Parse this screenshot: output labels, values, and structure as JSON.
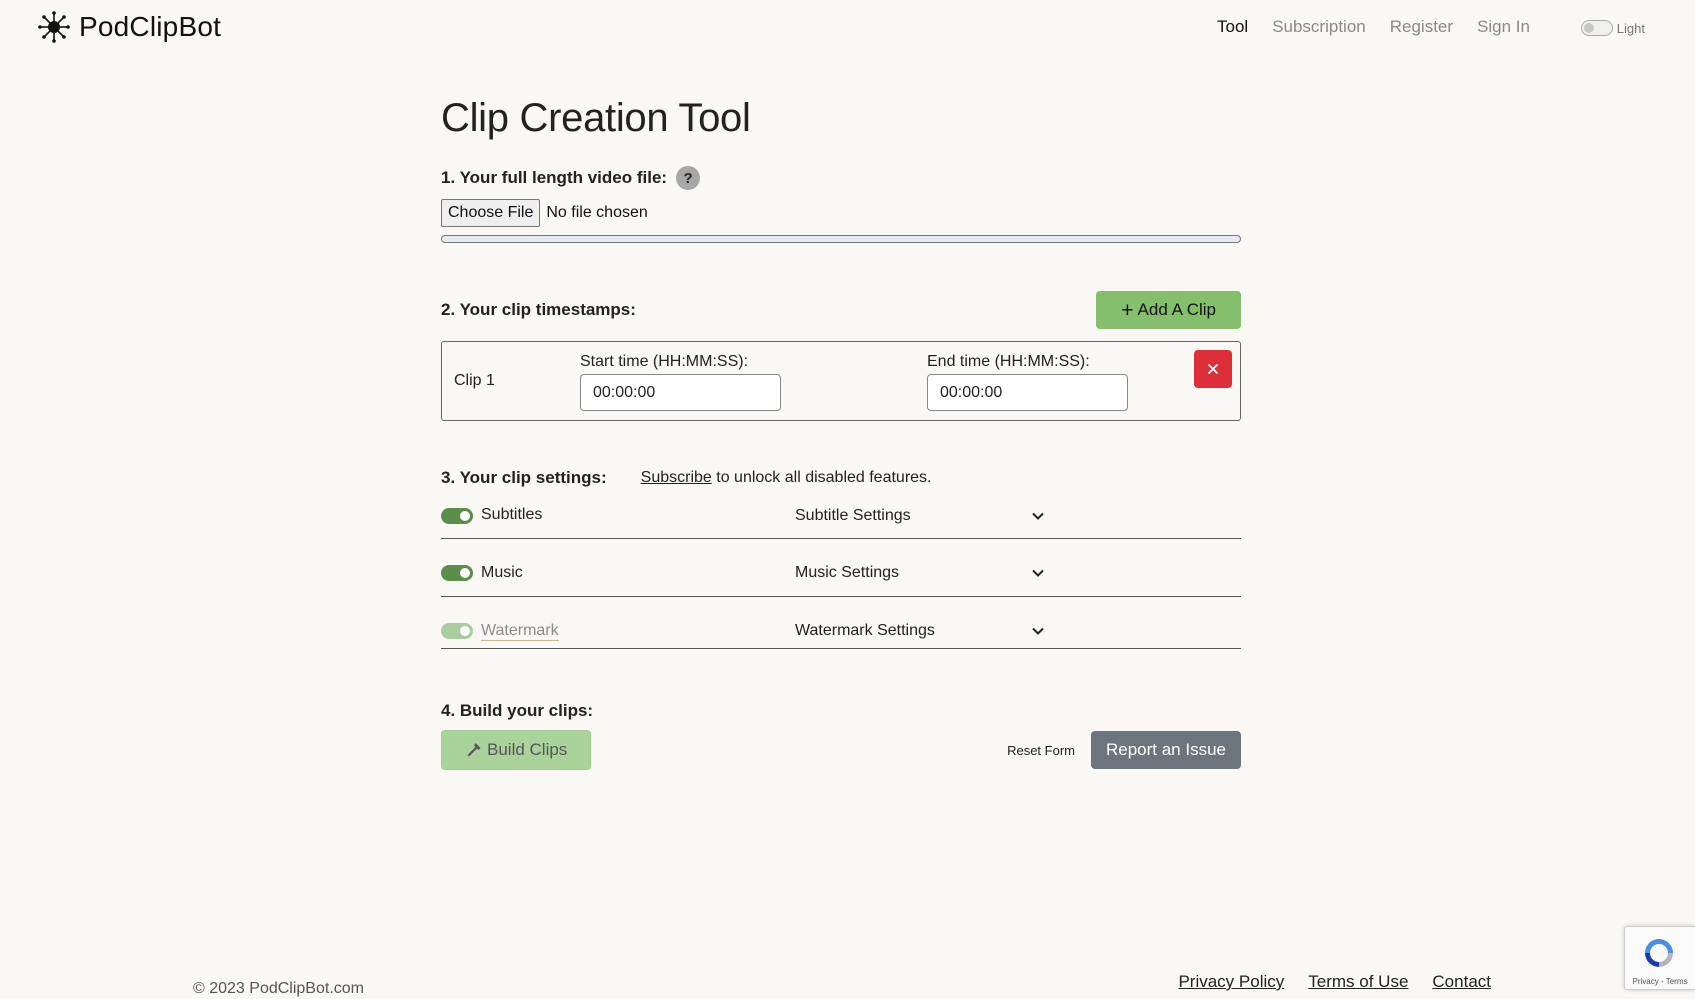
{
  "brand": {
    "name": "PodClipBot"
  },
  "nav": {
    "items": [
      {
        "label": "Tool"
      },
      {
        "label": "Subscription"
      },
      {
        "label": "Register"
      },
      {
        "label": "Sign In"
      }
    ],
    "theme_label": "Light"
  },
  "page": {
    "title": "Clip Creation Tool"
  },
  "step1": {
    "label": "1. Your full length video file:",
    "help_symbol": "?",
    "choose_file_label": "Choose File",
    "file_status": "No file chosen",
    "progress_percent": 0
  },
  "step2": {
    "label": "2. Your clip timestamps:",
    "add_clip_label": "Add A Clip",
    "clips": [
      {
        "label": "Clip 1",
        "start_label": "Start time (HH:MM:SS):",
        "start_value": "00:00:00",
        "end_label": "End time (HH:MM:SS):",
        "end_value": "00:00:00"
      }
    ]
  },
  "step3": {
    "label": "3. Your clip settings:",
    "subscribe_link": "Subscribe",
    "unlock_text": "to unlock all disabled features.",
    "features": [
      {
        "label": "Subtitles",
        "enabled": true,
        "disabled": false,
        "settings_label": "Subtitle Settings"
      },
      {
        "label": "Music",
        "enabled": true,
        "disabled": false,
        "settings_label": "Music Settings"
      },
      {
        "label": "Watermark",
        "enabled": true,
        "disabled": true,
        "settings_label": "Watermark Settings"
      }
    ]
  },
  "step4": {
    "label": "4. Build your clips:",
    "build_label": "Build Clips",
    "reset_label": "Reset Form",
    "report_label": "Report an Issue"
  },
  "footer": {
    "copyright": "© 2023 PodClipBot.com",
    "links": [
      {
        "label": "Privacy Policy"
      },
      {
        "label": "Terms of Use"
      },
      {
        "label": "Contact"
      }
    ]
  },
  "recaptcha": {
    "text": "Privacy - Terms"
  },
  "colors": {
    "background": "#f9f8f4",
    "success": "#84c06c",
    "toggle_on": "#5c8d4b",
    "danger": "#dc2f3a",
    "secondary": "#6c757d"
  }
}
